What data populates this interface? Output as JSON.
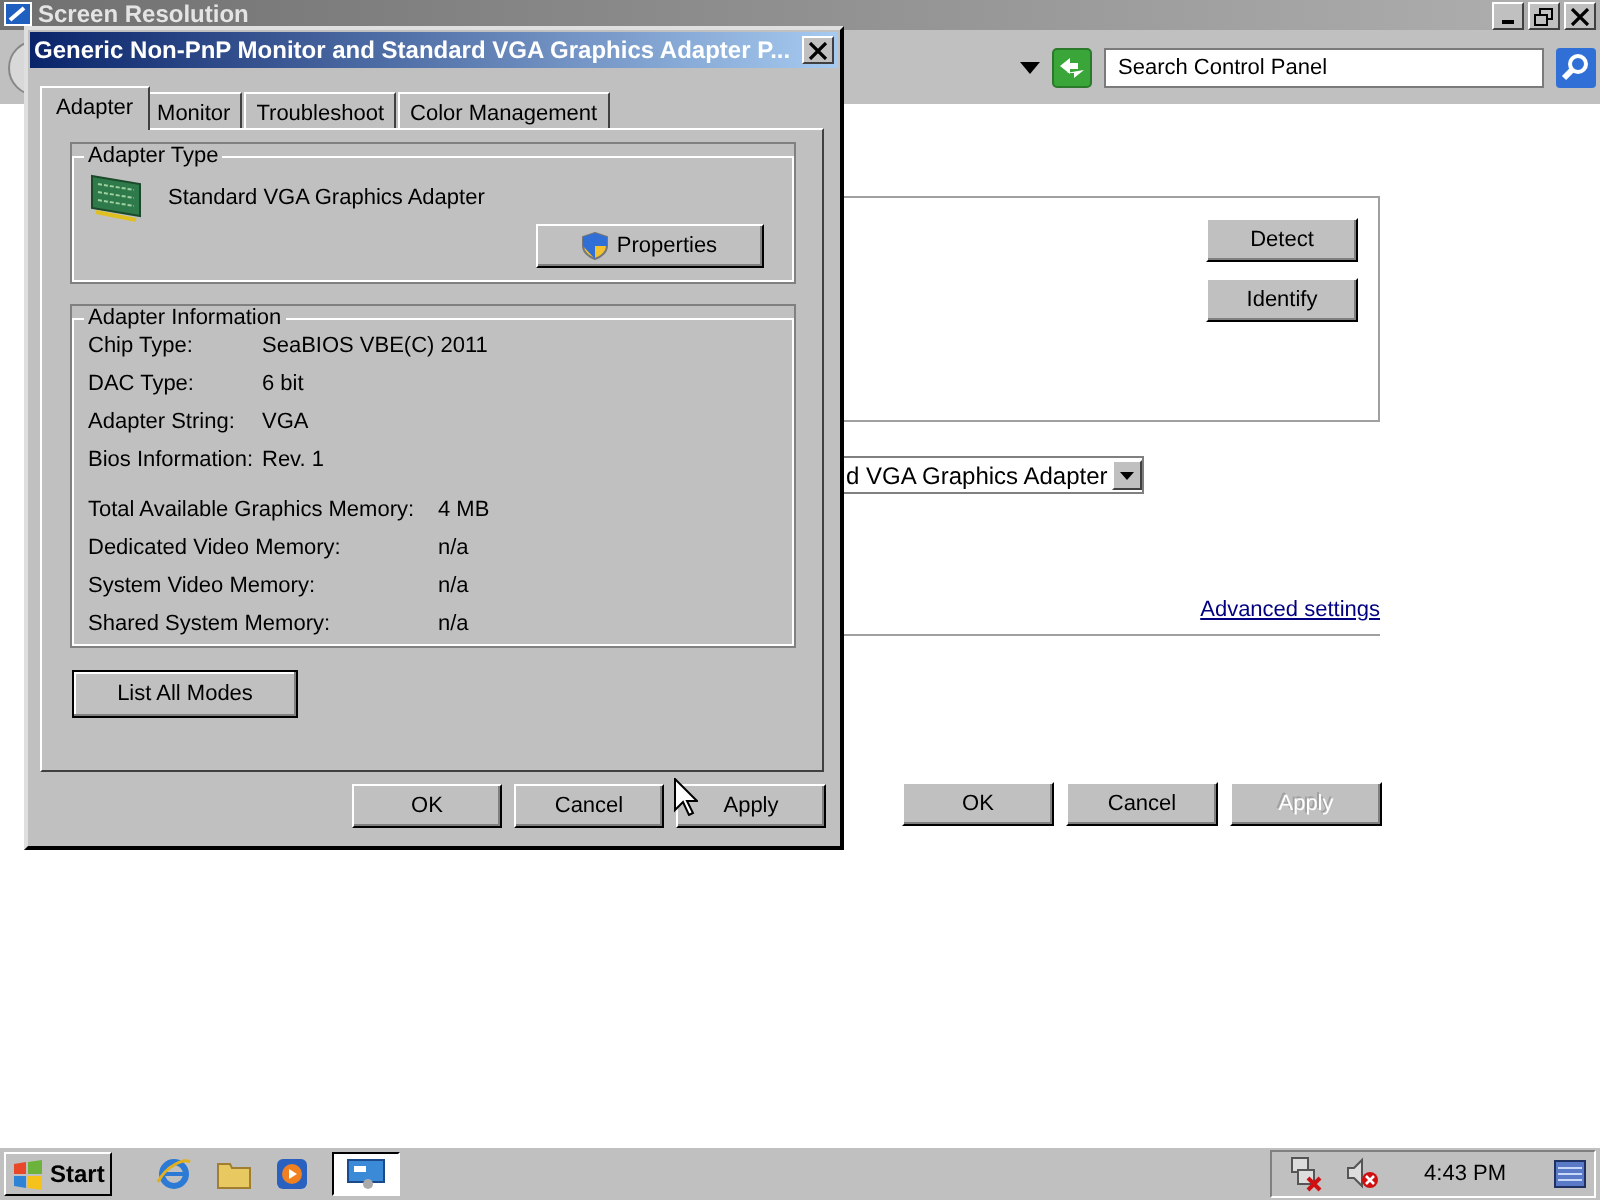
{
  "background_window": {
    "title": "Screen Resolution",
    "active": false,
    "search": {
      "placeholder": "Search Control Panel"
    },
    "side_buttons": [
      {
        "label": "Detect"
      },
      {
        "label": "Identify"
      }
    ],
    "display_dropdown": {
      "value": "d VGA Graphics Adapter"
    },
    "advanced_link": "Advanced settings",
    "buttons": [
      {
        "label": "OK",
        "disabled": false
      },
      {
        "label": "Cancel",
        "disabled": false
      },
      {
        "label": "Apply",
        "disabled": true
      }
    ]
  },
  "dialog": {
    "title": "Generic Non-PnP Monitor and Standard VGA Graphics Adapter P...",
    "active": true,
    "tabs": [
      {
        "label": "Adapter",
        "selected": true
      },
      {
        "label": "Monitor",
        "selected": false
      },
      {
        "label": "Troubleshoot",
        "selected": false
      },
      {
        "label": "Color Management",
        "selected": false
      }
    ],
    "adapter_type": {
      "heading": "Adapter Type",
      "name": "Standard VGA Graphics Adapter",
      "button": "Properties"
    },
    "adapter_information": {
      "heading": "Adapter Information",
      "rows": [
        {
          "label": "Chip Type:",
          "value": "SeaBIOS VBE(C) 2011"
        },
        {
          "label": "DAC Type:",
          "value": "6 bit"
        },
        {
          "label": "Adapter String:",
          "value": "VGA"
        },
        {
          "label": "Bios Information:",
          "value": "Rev. 1"
        }
      ],
      "memory_rows": [
        {
          "label": "Total Available Graphics Memory:",
          "value": "4 MB"
        },
        {
          "label": "Dedicated Video Memory:",
          "value": "n/a"
        },
        {
          "label": "System Video Memory:",
          "value": "n/a"
        },
        {
          "label": "Shared System Memory:",
          "value": "n/a"
        }
      ]
    },
    "list_button": "List All Modes",
    "buttons": [
      {
        "label": "OK",
        "disabled": false
      },
      {
        "label": "Cancel",
        "disabled": false
      },
      {
        "label": "Apply",
        "disabled": false
      }
    ]
  },
  "taskbar": {
    "start": "Start",
    "clock": "4:43 PM"
  }
}
